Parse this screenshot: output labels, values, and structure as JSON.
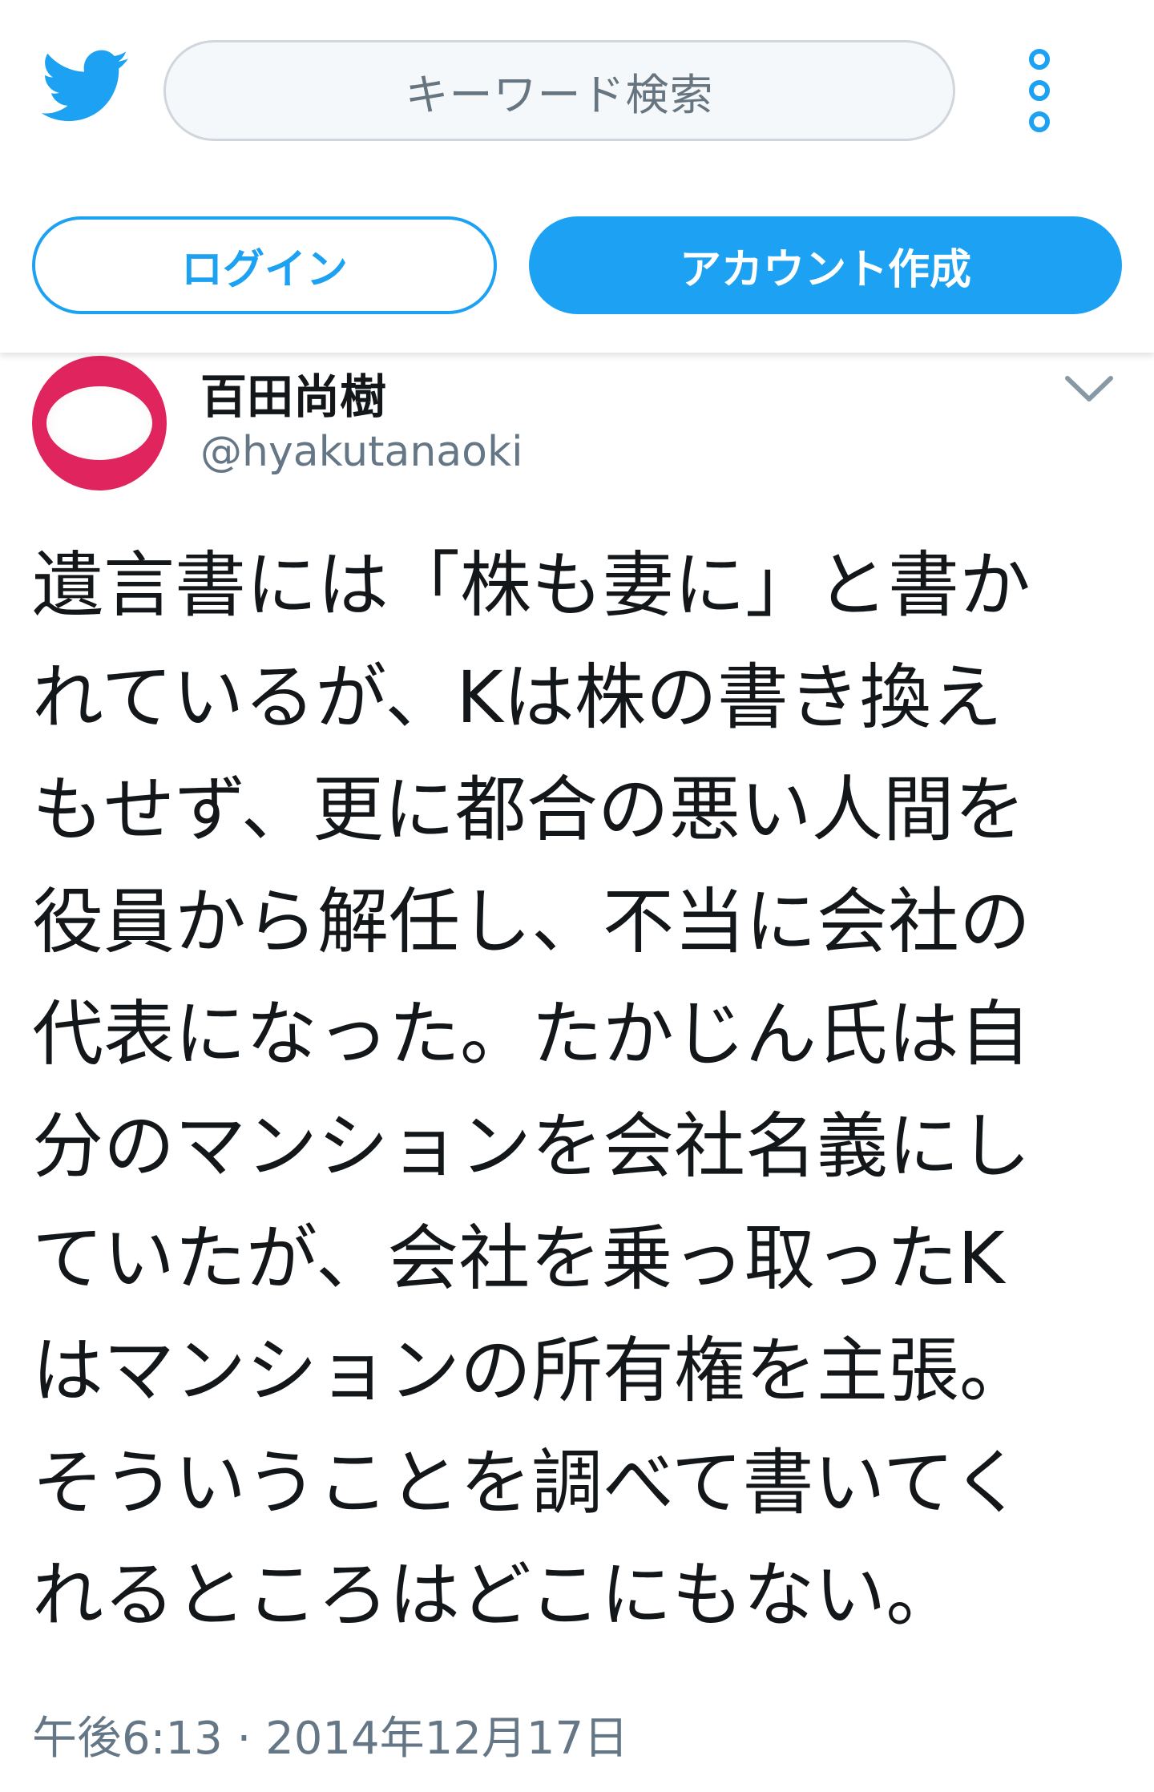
{
  "header": {
    "search_placeholder": "キーワード検索",
    "login_label": "ログイン",
    "signup_label": "アカウント作成"
  },
  "tweet": {
    "author_name": "百田尚樹",
    "author_handle": "@hyakutanaoki",
    "text": "遺言書には「株も妻に」と書か\nれているが、Kは株の書き換え\nもせず、更に都合の悪い人間を\n役員から解任し、不当に会社の\n代表になった。たかじん氏は自\n分のマンションを会社名義にし\nていたが、会社を乗っ取ったK\nはマンションの所有権を主張。\nそういうことを調べて書いてく\nれるところはどこにもない。",
    "timestamp": "午後6:13 · 2014年12月17日"
  },
  "colors": {
    "brand_blue": "#1da1f2",
    "avatar_red": "#e0245e",
    "secondary_text": "#657786"
  },
  "icons": [
    "twitter-bird-icon",
    "more-vertical-icon",
    "chevron-down-icon"
  ]
}
